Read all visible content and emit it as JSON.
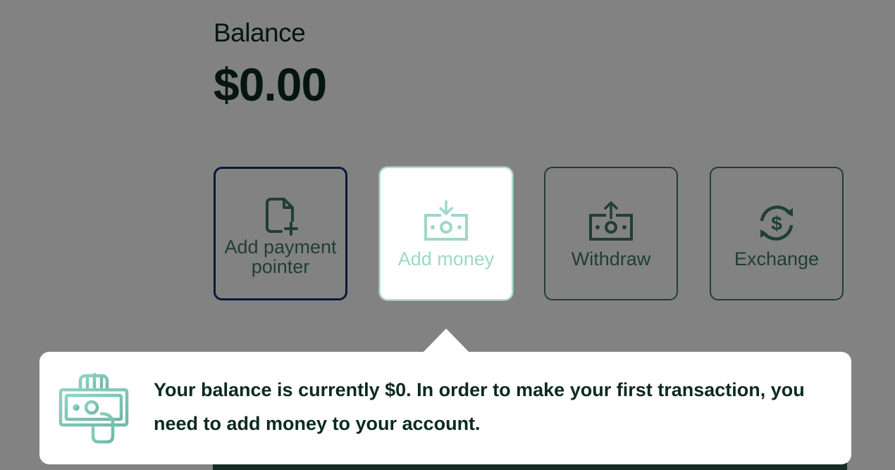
{
  "balance": {
    "label": "Balance",
    "amount": "$0.00"
  },
  "actions": [
    {
      "label": "Add payment pointer",
      "icon": "add-document-icon"
    },
    {
      "label": "Add money",
      "icon": "deposit-cash-icon"
    },
    {
      "label": "Withdraw",
      "icon": "withdraw-cash-icon"
    },
    {
      "label": "Exchange",
      "icon": "currency-exchange-icon"
    }
  ],
  "tooltip": {
    "icon": "hand-holding-cash-icon",
    "message": "Your balance is currently $0. In order to make your first transaction, you need to add money to your account."
  },
  "colors": {
    "primary_green": "#3f7a6a",
    "highlight_mint": "#9dd8c9",
    "focus_blue": "#16306e",
    "text_dark": "#0c2a20"
  }
}
